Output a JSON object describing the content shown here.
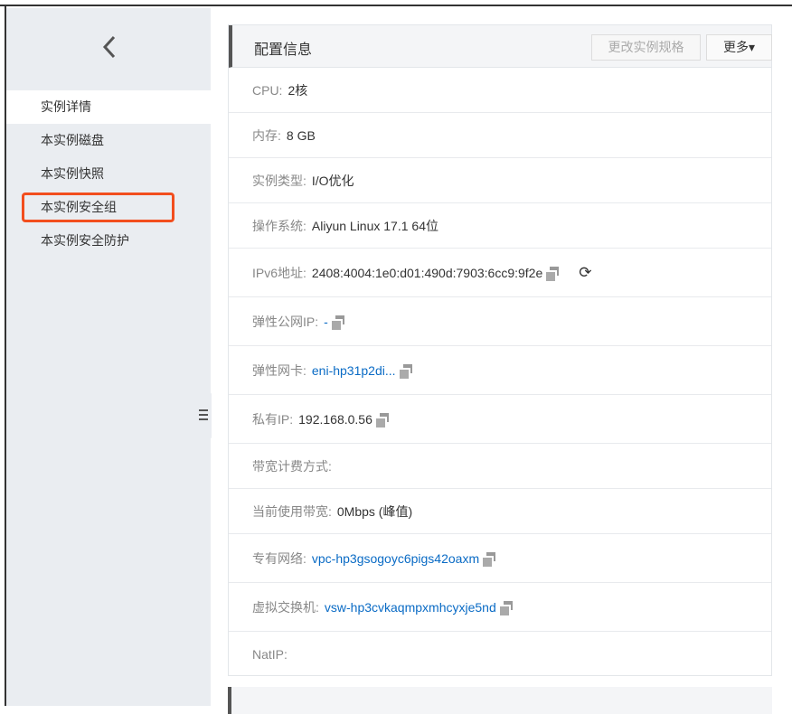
{
  "sidebar": {
    "items": [
      {
        "label": "实例详情",
        "active": true
      },
      {
        "label": "本实例磁盘"
      },
      {
        "label": "本实例快照"
      },
      {
        "label": "本实例安全组",
        "highlighted": true
      },
      {
        "label": "本实例安全防护"
      }
    ]
  },
  "card": {
    "title": "配置信息",
    "resize_button": "更改实例规格",
    "more_button": "更多▾",
    "rows": [
      {
        "label": "CPU:",
        "value": "2核"
      },
      {
        "label": "内存:",
        "value": "8 GB"
      },
      {
        "label": "实例类型:",
        "value": "I/O优化"
      },
      {
        "label": "操作系统:",
        "value": "Aliyun Linux 17.1 64位"
      },
      {
        "label": "IPv6地址:",
        "value": "2408:4004:1e0:d01:490d:7903:6cc9:9f2e"
      },
      {
        "label": "弹性公网IP:",
        "value": "-"
      },
      {
        "label": "弹性网卡:",
        "value": "eni-hp31p2di..."
      },
      {
        "label": "私有IP:",
        "value": "192.168.0.56"
      },
      {
        "label": "带宽计费方式:",
        "value": ""
      },
      {
        "label": "当前使用带宽:",
        "value": "0Mbps (峰值)"
      },
      {
        "label": "专有网络:",
        "value": "vpc-hp3gsogoyc6pigs42oaxm"
      },
      {
        "label": "虚拟交换机:",
        "value": "vsw-hp3cvkaqmpxmhcyxje5nd"
      },
      {
        "label": "NatIP:",
        "value": ""
      }
    ]
  },
  "colors": {
    "highlight": "#f24e1e",
    "link": "#0a6bc5"
  }
}
